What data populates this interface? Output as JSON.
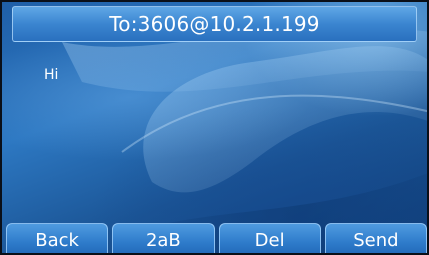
{
  "header": {
    "title": "To:3606@10.2.1.199"
  },
  "message": {
    "text": "Hi"
  },
  "softkeys": [
    {
      "label": "Back"
    },
    {
      "label": "2aB"
    },
    {
      "label": "Del"
    },
    {
      "label": "Send"
    }
  ]
}
